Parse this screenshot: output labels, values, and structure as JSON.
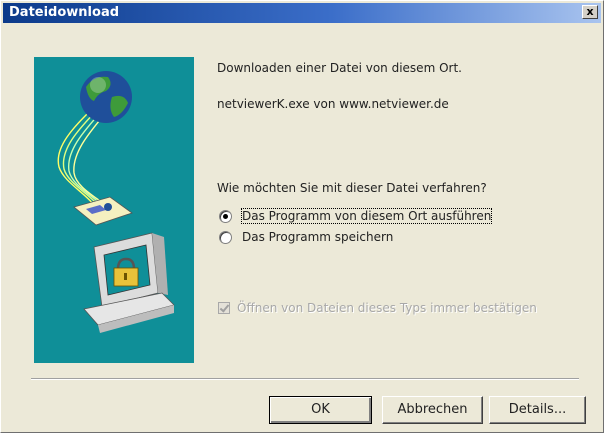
{
  "window": {
    "title": "Dateidownload",
    "close_glyph": "x"
  },
  "illustration": {
    "icons": [
      "globe-icon",
      "floppy-disk-icon",
      "computer-icon",
      "padlock-icon"
    ],
    "background_color": "#0f8f98"
  },
  "content": {
    "line1": "Downloaden einer Datei von diesem Ort.",
    "line2": "netviewerK.exe von www.netviewer.de",
    "question": "Wie möchten Sie mit dieser Datei verfahren?"
  },
  "options": [
    {
      "label": "Das Programm von diesem Ort ausführen",
      "selected": true
    },
    {
      "label": "Das Programm speichern",
      "selected": false
    }
  ],
  "confirm_checkbox": {
    "label": "Öffnen von Dateien dieses Typs immer bestätigen",
    "checked": true,
    "disabled": true
  },
  "buttons": {
    "ok": "OK",
    "cancel": "Abbrechen",
    "details": "Details..."
  }
}
